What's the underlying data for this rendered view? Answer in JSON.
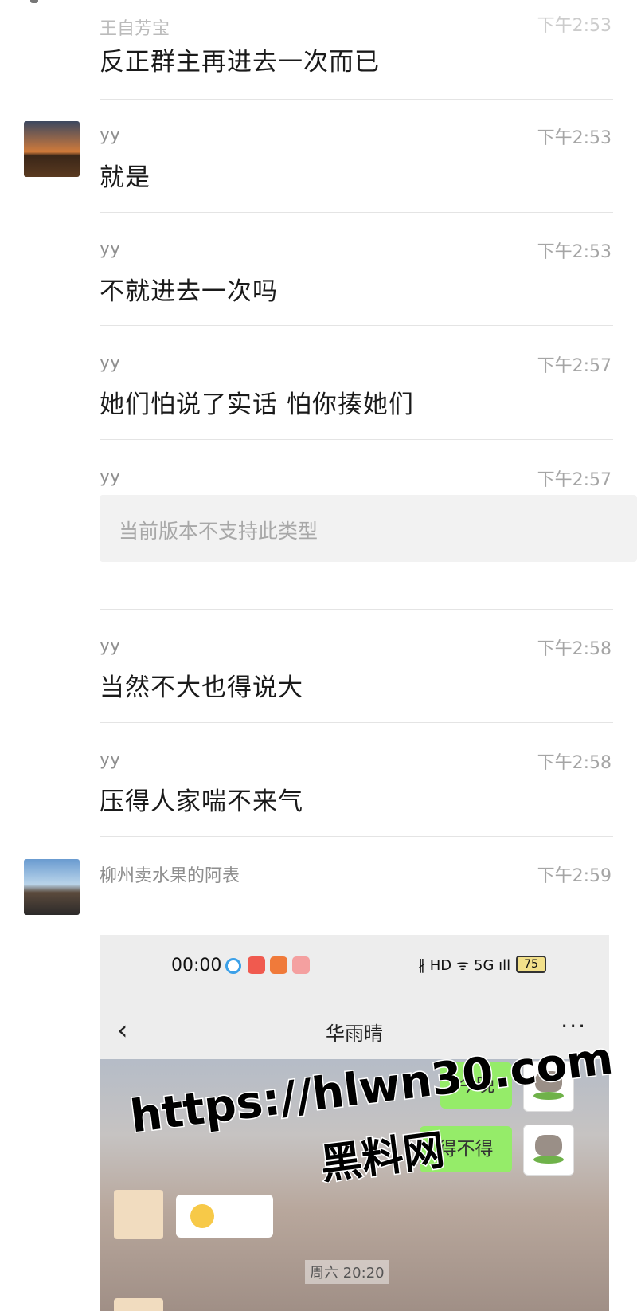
{
  "partial_top": {
    "sender": "王自芳宝",
    "time": "下午2:53"
  },
  "messages": [
    {
      "sender": "",
      "time": "",
      "text": "反正群主再进去一次而已"
    },
    {
      "sender": "yy",
      "time": "下午2:53",
      "text": "就是"
    },
    {
      "sender": "yy",
      "time": "下午2:53",
      "text": "不就进去一次吗"
    },
    {
      "sender": "yy",
      "time": "下午2:57",
      "text": "她们怕说了实话 怕你揍她们"
    },
    {
      "sender": "yy",
      "time": "下午2:57",
      "text": "当前版本不支持此类型"
    },
    {
      "sender": "yy",
      "time": "下午2:58",
      "text": "当然不大也得说大"
    },
    {
      "sender": "yy",
      "time": "下午2:58",
      "text": "压得人家喘不来气"
    },
    {
      "sender": "柳州卖水果的阿表",
      "time": "下午2:59",
      "text": ""
    }
  ],
  "embedded_screenshot": {
    "clock": "00:00",
    "status_icons": "∦ HD ᯤ 5G ıll",
    "battery": "75",
    "back_icon": "chevron-left-icon",
    "title": "华雨晴",
    "more_icon": "more-icon",
    "bubbles": [
      "今晚",
      "得不得"
    ],
    "time_chip": "周六 20:20"
  },
  "watermark": {
    "line1": "https://hlwn30.com",
    "line2": "黑料网"
  }
}
